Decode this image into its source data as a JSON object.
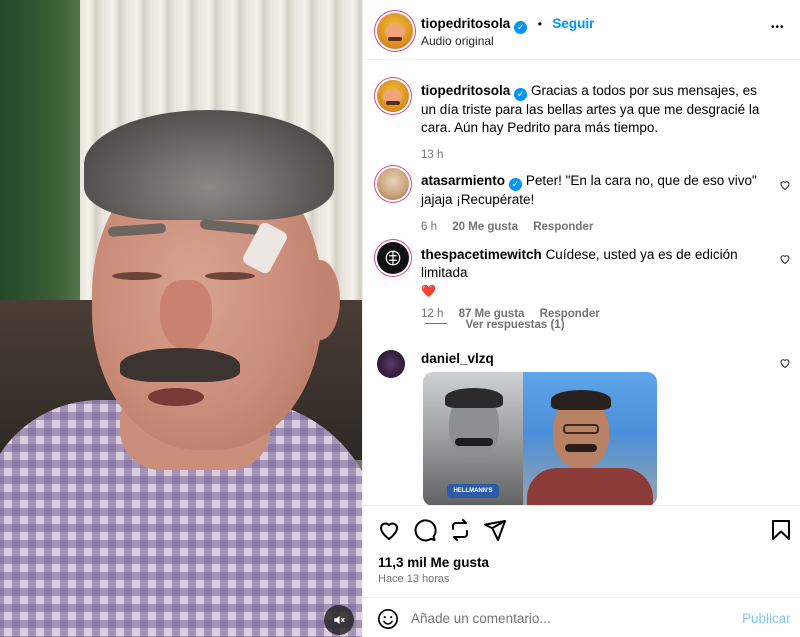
{
  "post": {
    "author": "tiopedritosola",
    "follow_label": "Seguir",
    "dot": "•",
    "audio_label": "Audio original",
    "more_label": "•••"
  },
  "caption": {
    "author": "tiopedritosola",
    "text": "Gracias a todos por sus mensajes, es un día triste para las bellas artes ya que me desgracié la cara. Aún hay Pedrito para más tiempo.",
    "time": "13 h"
  },
  "comments": [
    {
      "author": "atasarmiento",
      "verified": true,
      "text": "Peter! \"En la cara no, que de eso vivo\" jajaja ¡Recupérate!",
      "time": "6 h",
      "likes": "20 Me gusta",
      "reply_label": "Responder"
    },
    {
      "author": "thespacetimewitch",
      "verified": false,
      "text": "Cuídese, usted ya es de edición limitada",
      "emoji": "❤️",
      "time": "12 h",
      "likes": "87 Me gusta",
      "reply_label": "Responder",
      "view_replies": "Ver respuestas (1)"
    },
    {
      "author": "daniel_vlzq",
      "verified": false,
      "photo_caption": "HELLMANN'S"
    }
  ],
  "actions": {
    "like_count": "11,3 mil Me gusta",
    "posted_ago": "Hace 13 horas"
  },
  "composer": {
    "placeholder": "Añade un comentario...",
    "publish_label": "Publicar"
  },
  "colors": {
    "accent": "#0095f6",
    "heart": "#ed4956",
    "muted": "#737373"
  }
}
